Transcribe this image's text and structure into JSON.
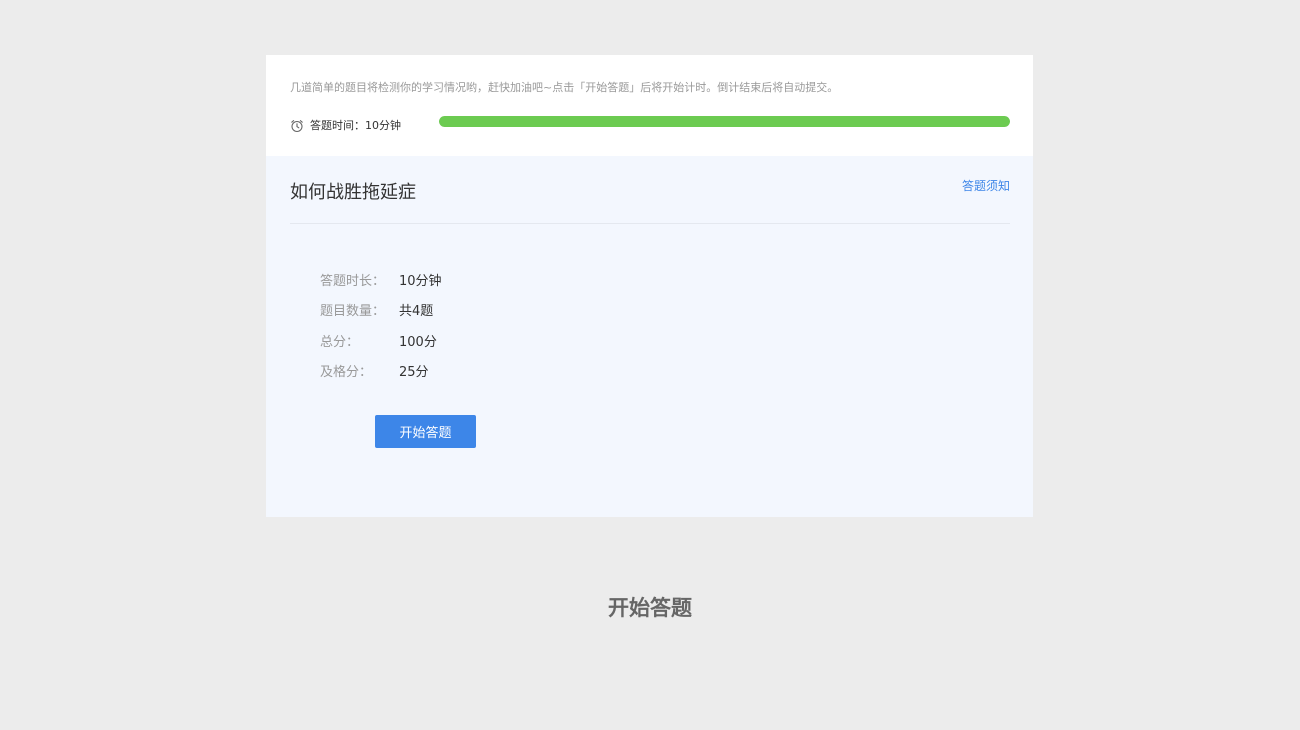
{
  "intro_text": "几道简单的题目将检测你的学习情况哟，赶快加油吧~点击「开始答题」后将开始计时。倒计结束后将自动提交。",
  "timer": {
    "icon": "alarm-clock-icon",
    "label": "答题时间：10分钟",
    "progress_fraction": 1.0
  },
  "quiz": {
    "title": "如何战胜拖延症",
    "notice_link": "答题须知"
  },
  "info": [
    {
      "label": "答题时长：",
      "value": "10分钟"
    },
    {
      "label": "题目数量：",
      "value": "共4题"
    },
    {
      "label": "总分：",
      "value": "100分"
    },
    {
      "label": "及格分：",
      "value": "25分"
    }
  ],
  "start_button": "开始答题",
  "page_caption": "开始答题",
  "colors": {
    "accent": "#3d86e8",
    "progress": "#6ccb51",
    "card_bg": "#f3f7fe",
    "page_bg": "#ececec"
  }
}
